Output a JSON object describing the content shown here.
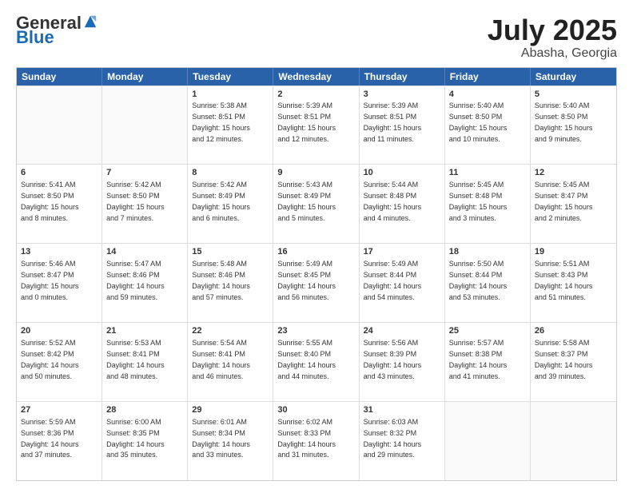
{
  "logo": {
    "general": "General",
    "blue": "Blue"
  },
  "title": "July 2025",
  "location": "Abasha, Georgia",
  "days": [
    "Sunday",
    "Monday",
    "Tuesday",
    "Wednesday",
    "Thursday",
    "Friday",
    "Saturday"
  ],
  "weeks": [
    [
      {
        "day": "",
        "content": ""
      },
      {
        "day": "",
        "content": ""
      },
      {
        "day": "1",
        "content": "Sunrise: 5:38 AM\nSunset: 8:51 PM\nDaylight: 15 hours\nand 12 minutes."
      },
      {
        "day": "2",
        "content": "Sunrise: 5:39 AM\nSunset: 8:51 PM\nDaylight: 15 hours\nand 12 minutes."
      },
      {
        "day": "3",
        "content": "Sunrise: 5:39 AM\nSunset: 8:51 PM\nDaylight: 15 hours\nand 11 minutes."
      },
      {
        "day": "4",
        "content": "Sunrise: 5:40 AM\nSunset: 8:50 PM\nDaylight: 15 hours\nand 10 minutes."
      },
      {
        "day": "5",
        "content": "Sunrise: 5:40 AM\nSunset: 8:50 PM\nDaylight: 15 hours\nand 9 minutes."
      }
    ],
    [
      {
        "day": "6",
        "content": "Sunrise: 5:41 AM\nSunset: 8:50 PM\nDaylight: 15 hours\nand 8 minutes."
      },
      {
        "day": "7",
        "content": "Sunrise: 5:42 AM\nSunset: 8:50 PM\nDaylight: 15 hours\nand 7 minutes."
      },
      {
        "day": "8",
        "content": "Sunrise: 5:42 AM\nSunset: 8:49 PM\nDaylight: 15 hours\nand 6 minutes."
      },
      {
        "day": "9",
        "content": "Sunrise: 5:43 AM\nSunset: 8:49 PM\nDaylight: 15 hours\nand 5 minutes."
      },
      {
        "day": "10",
        "content": "Sunrise: 5:44 AM\nSunset: 8:48 PM\nDaylight: 15 hours\nand 4 minutes."
      },
      {
        "day": "11",
        "content": "Sunrise: 5:45 AM\nSunset: 8:48 PM\nDaylight: 15 hours\nand 3 minutes."
      },
      {
        "day": "12",
        "content": "Sunrise: 5:45 AM\nSunset: 8:47 PM\nDaylight: 15 hours\nand 2 minutes."
      }
    ],
    [
      {
        "day": "13",
        "content": "Sunrise: 5:46 AM\nSunset: 8:47 PM\nDaylight: 15 hours\nand 0 minutes."
      },
      {
        "day": "14",
        "content": "Sunrise: 5:47 AM\nSunset: 8:46 PM\nDaylight: 14 hours\nand 59 minutes."
      },
      {
        "day": "15",
        "content": "Sunrise: 5:48 AM\nSunset: 8:46 PM\nDaylight: 14 hours\nand 57 minutes."
      },
      {
        "day": "16",
        "content": "Sunrise: 5:49 AM\nSunset: 8:45 PM\nDaylight: 14 hours\nand 56 minutes."
      },
      {
        "day": "17",
        "content": "Sunrise: 5:49 AM\nSunset: 8:44 PM\nDaylight: 14 hours\nand 54 minutes."
      },
      {
        "day": "18",
        "content": "Sunrise: 5:50 AM\nSunset: 8:44 PM\nDaylight: 14 hours\nand 53 minutes."
      },
      {
        "day": "19",
        "content": "Sunrise: 5:51 AM\nSunset: 8:43 PM\nDaylight: 14 hours\nand 51 minutes."
      }
    ],
    [
      {
        "day": "20",
        "content": "Sunrise: 5:52 AM\nSunset: 8:42 PM\nDaylight: 14 hours\nand 50 minutes."
      },
      {
        "day": "21",
        "content": "Sunrise: 5:53 AM\nSunset: 8:41 PM\nDaylight: 14 hours\nand 48 minutes."
      },
      {
        "day": "22",
        "content": "Sunrise: 5:54 AM\nSunset: 8:41 PM\nDaylight: 14 hours\nand 46 minutes."
      },
      {
        "day": "23",
        "content": "Sunrise: 5:55 AM\nSunset: 8:40 PM\nDaylight: 14 hours\nand 44 minutes."
      },
      {
        "day": "24",
        "content": "Sunrise: 5:56 AM\nSunset: 8:39 PM\nDaylight: 14 hours\nand 43 minutes."
      },
      {
        "day": "25",
        "content": "Sunrise: 5:57 AM\nSunset: 8:38 PM\nDaylight: 14 hours\nand 41 minutes."
      },
      {
        "day": "26",
        "content": "Sunrise: 5:58 AM\nSunset: 8:37 PM\nDaylight: 14 hours\nand 39 minutes."
      }
    ],
    [
      {
        "day": "27",
        "content": "Sunrise: 5:59 AM\nSunset: 8:36 PM\nDaylight: 14 hours\nand 37 minutes."
      },
      {
        "day": "28",
        "content": "Sunrise: 6:00 AM\nSunset: 8:35 PM\nDaylight: 14 hours\nand 35 minutes."
      },
      {
        "day": "29",
        "content": "Sunrise: 6:01 AM\nSunset: 8:34 PM\nDaylight: 14 hours\nand 33 minutes."
      },
      {
        "day": "30",
        "content": "Sunrise: 6:02 AM\nSunset: 8:33 PM\nDaylight: 14 hours\nand 31 minutes."
      },
      {
        "day": "31",
        "content": "Sunrise: 6:03 AM\nSunset: 8:32 PM\nDaylight: 14 hours\nand 29 minutes."
      },
      {
        "day": "",
        "content": ""
      },
      {
        "day": "",
        "content": ""
      }
    ]
  ]
}
